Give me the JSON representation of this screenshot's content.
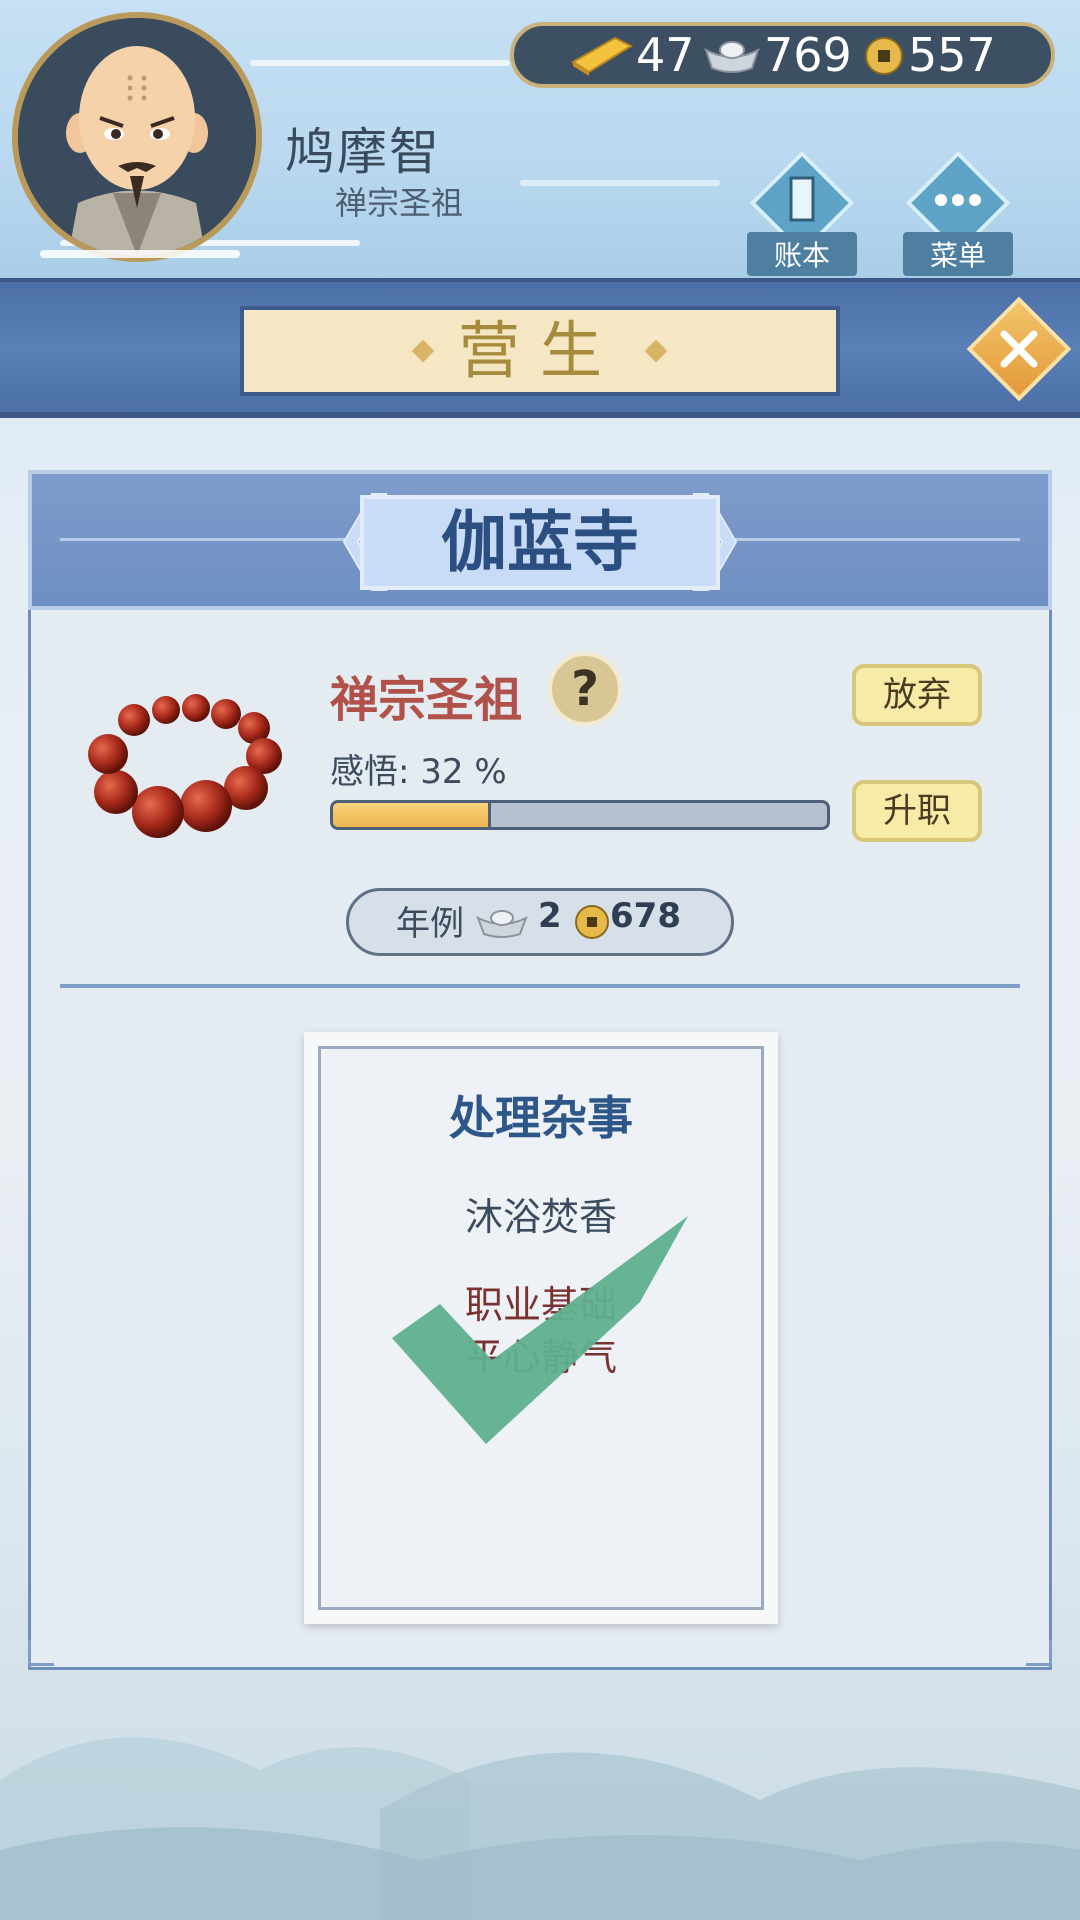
{
  "currency": {
    "gold": "47",
    "silver": "769",
    "coin": "557"
  },
  "player": {
    "name": "鸠摩智",
    "title": "禅宗圣祖"
  },
  "nav": {
    "ledger_label": "账本",
    "menu_label": "菜单"
  },
  "banner": {
    "title": "营生"
  },
  "location": {
    "name": "伽蓝寺"
  },
  "job": {
    "title": "禅宗圣祖",
    "help_symbol": "?",
    "enlightenment_label": "感悟: 32 %",
    "enlightenment_progress": 0.32,
    "abandon_label": "放弃",
    "promote_label": "升职"
  },
  "salary": {
    "label": "年例",
    "silver": "2",
    "coin": "678"
  },
  "task": {
    "title": "处理杂事",
    "activity": "沐浴焚香",
    "foundation": "职业基础",
    "foundation_item": "平心静气",
    "completed": true
  },
  "colors": {
    "accent_blue": "#4c6fa7",
    "check_green": "#5fb08f",
    "job_red": "#b0514a"
  }
}
